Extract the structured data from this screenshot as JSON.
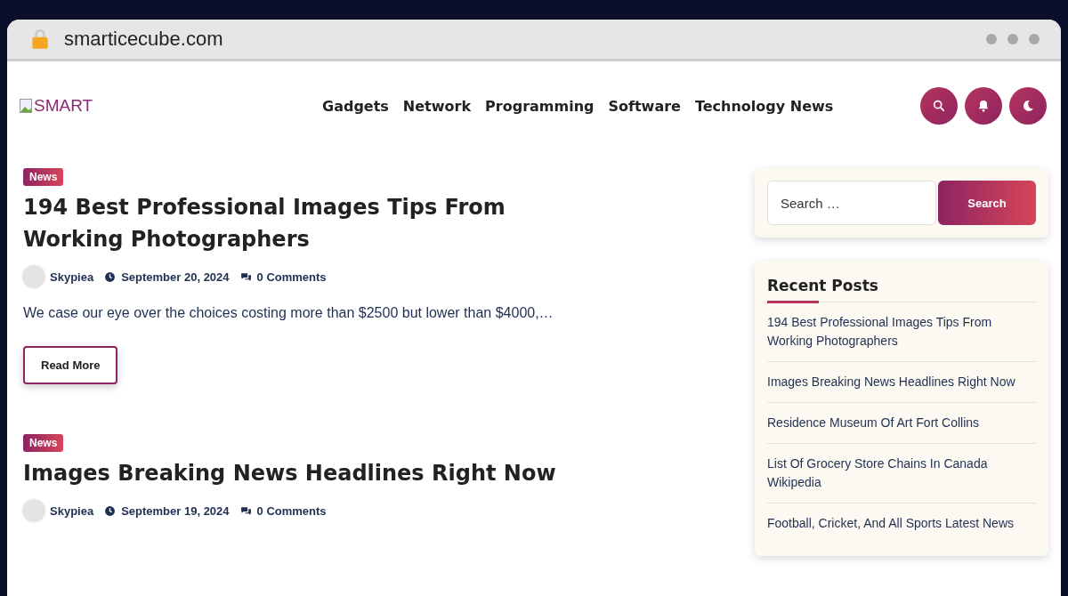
{
  "browser": {
    "url": "smarticecube.com"
  },
  "header": {
    "logo": "SMART",
    "nav": [
      "Gadgets",
      "Network",
      "Programming",
      "Software",
      "Technology News"
    ],
    "actions": [
      {
        "kind": "search"
      },
      {
        "kind": "bell"
      },
      {
        "kind": "moon"
      }
    ]
  },
  "posts": [
    {
      "category": "News",
      "title": "194 Best Professional Images Tips From Working Photographers",
      "author": "Skypiea",
      "date": "September 20, 2024",
      "comments": "0 Comments",
      "excerpt": "We case our eye over the choices costing more than $2500 but lower than $4000,…",
      "button": "Read More"
    },
    {
      "category": "News",
      "title": "Images Breaking News Headlines Right Now",
      "author": "Skypiea",
      "date": "September 19, 2024",
      "comments": "0 Comments"
    }
  ],
  "sidebar": {
    "search": {
      "placeholder": "Search …",
      "button": "Search"
    },
    "recent_posts": {
      "title": "Recent Posts",
      "items": [
        "194 Best Professional Images Tips From Working Photographers",
        "Images Breaking News Headlines Right Now",
        "Residence Museum Of Art Fort Collins",
        "List Of Grocery Store Chains In Canada Wikipedia",
        "Football, Cricket, And All Sports Latest News"
      ]
    }
  }
}
